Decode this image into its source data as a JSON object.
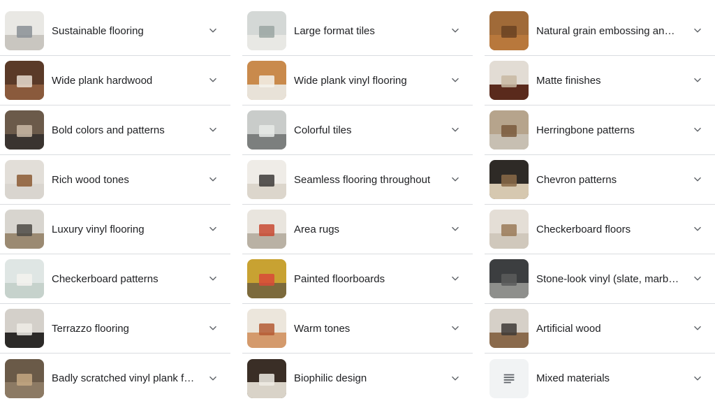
{
  "columns": [
    {
      "items": [
        {
          "label": "Sustainable flooring",
          "icon": "sustainable-flooring-thumbnail",
          "colors": {
            "wall": "#e9e8e4",
            "floor": "#c9c6c0",
            "accent": "#8a8f95"
          }
        },
        {
          "label": "Wide plank hardwood",
          "icon": "wide-plank-hardwood-thumbnail",
          "colors": {
            "wall": "#5a3a28",
            "floor": "#8a5a3c",
            "accent": "#e8ddd0"
          }
        },
        {
          "label": "Bold colors and patterns",
          "icon": "bold-colors-thumbnail",
          "colors": {
            "wall": "#6b5a4a",
            "floor": "#3a3430",
            "accent": "#c9b9a4"
          }
        },
        {
          "label": "Rich wood tones",
          "icon": "rich-wood-tones-thumbnail",
          "colors": {
            "wall": "#e2ded8",
            "floor": "#d9d5cf",
            "accent": "#8b5a34"
          }
        },
        {
          "label": "Luxury vinyl flooring",
          "icon": "luxury-vinyl-thumbnail",
          "colors": {
            "wall": "#d8d5cf",
            "floor": "#9b8a72",
            "accent": "#4d4a45"
          }
        },
        {
          "label": "Checkerboard patterns",
          "icon": "checkerboard-patterns-thumbnail",
          "colors": {
            "wall": "#dfe6e4",
            "floor": "#c6d2cc",
            "accent": "#f4f2ee"
          }
        },
        {
          "label": "Terrazzo flooring",
          "icon": "terrazzo-thumbnail",
          "colors": {
            "wall": "#d4d0ca",
            "floor": "#2c2a28",
            "accent": "#efece6"
          }
        },
        {
          "label": "Badly scratched vinyl plank fl…",
          "icon": "scratched-vinyl-thumbnail",
          "colors": {
            "wall": "#6a5a48",
            "floor": "#8c7a64",
            "accent": "#c4a882"
          }
        }
      ]
    },
    {
      "items": [
        {
          "label": "Large format tiles",
          "icon": "large-format-tiles-thumbnail",
          "colors": {
            "wall": "#d4d8d6",
            "floor": "#e8e8e4",
            "accent": "#9aa6a2"
          }
        },
        {
          "label": "Wide plank vinyl flooring",
          "icon": "wide-plank-vinyl-thumbnail",
          "colors": {
            "wall": "#c98a4c",
            "floor": "#e8e2d8",
            "accent": "#f5f2ec"
          }
        },
        {
          "label": "Colorful tiles",
          "icon": "colorful-tiles-thumbnail",
          "colors": {
            "wall": "#c9ccca",
            "floor": "#7c7f7e",
            "accent": "#e8eae8"
          }
        },
        {
          "label": "Seamless flooring throughout",
          "icon": "seamless-flooring-thumbnail",
          "colors": {
            "wall": "#efece7",
            "floor": "#dcd6cc",
            "accent": "#3d3b38"
          }
        },
        {
          "label": "Area rugs",
          "icon": "area-rugs-thumbnail",
          "colors": {
            "wall": "#e9e5de",
            "floor": "#b9b1a4",
            "accent": "#c84a32"
          }
        },
        {
          "label": "Painted floorboards",
          "icon": "painted-floorboards-thumbnail",
          "colors": {
            "wall": "#c8a232",
            "floor": "#7c6a3c",
            "accent": "#d84a38"
          }
        },
        {
          "label": "Warm tones",
          "icon": "warm-tones-thumbnail",
          "colors": {
            "wall": "#ece6dc",
            "floor": "#d49a6c",
            "accent": "#b45a34"
          }
        },
        {
          "label": "Biophilic design",
          "icon": "biophilic-design-thumbnail",
          "colors": {
            "wall": "#3a2e26",
            "floor": "#d9d3c8",
            "accent": "#efebe4"
          }
        }
      ]
    },
    {
      "items": [
        {
          "label": "Natural grain embossing and …",
          "icon": "natural-grain-thumbnail",
          "colors": {
            "wall": "#a06a38",
            "floor": "#b8783c",
            "accent": "#6a4222"
          }
        },
        {
          "label": "Matte finishes",
          "icon": "matte-finishes-thumbnail",
          "colors": {
            "wall": "#e2dcd4",
            "floor": "#5a2a1c",
            "accent": "#c8b8a2"
          }
        },
        {
          "label": "Herringbone patterns",
          "icon": "herringbone-thumbnail",
          "colors": {
            "wall": "#b6a48c",
            "floor": "#c7bfb2",
            "accent": "#7a5a3c"
          }
        },
        {
          "label": "Chevron patterns",
          "icon": "chevron-patterns-thumbnail",
          "colors": {
            "wall": "#2e2a26",
            "floor": "#d6c8b0",
            "accent": "#8a6a48"
          }
        },
        {
          "label": "Checkerboard floors",
          "icon": "checkerboard-floors-thumbnail",
          "colors": {
            "wall": "#e4ded6",
            "floor": "#d0c8bc",
            "accent": "#9a7a58"
          }
        },
        {
          "label": "Stone-look vinyl (slate, marbl…",
          "icon": "stone-look-vinyl-thumbnail",
          "colors": {
            "wall": "#3c3e40",
            "floor": "#8e8f8c",
            "accent": "#5a5c5c"
          }
        },
        {
          "label": "Artificial wood",
          "icon": "artificial-wood-thumbnail",
          "colors": {
            "wall": "#d6d0c8",
            "floor": "#8a6a4c",
            "accent": "#3e3a36"
          }
        },
        {
          "label": "Mixed materials",
          "icon": "document-lines-icon",
          "doc": true
        }
      ]
    }
  ]
}
